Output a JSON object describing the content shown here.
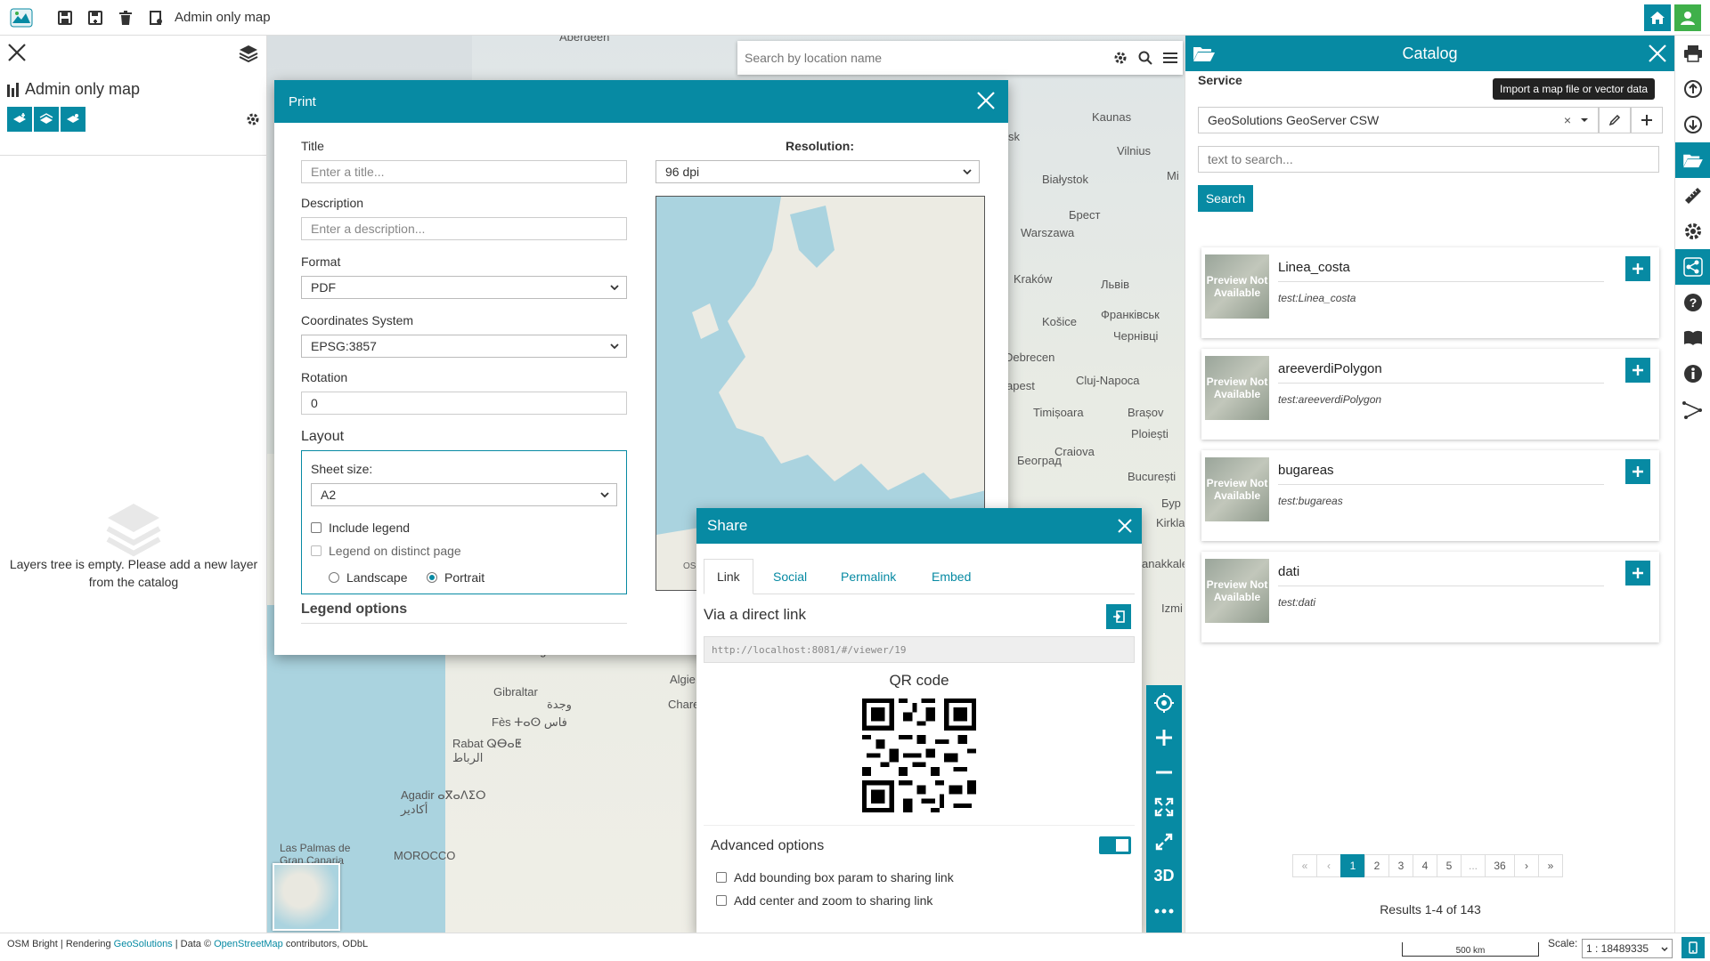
{
  "topbar": {
    "title": "Admin only map"
  },
  "left_panel": {
    "title": "Admin only map",
    "empty_message": "Layers tree is empty. Please add a new layer from the catalog"
  },
  "search": {
    "placeholder": "Search by location name"
  },
  "map_labels": [
    "Aberdeen",
    "Kaunas",
    "Vilnius",
    "Białystok",
    "Брест",
    "Warszawa",
    "Kraków",
    "Львів",
    "Košice",
    "Франківськ",
    "Чернівці",
    "Debrecen",
    "Cluj-Napoca",
    "apest",
    "Timișoara",
    "Brașov",
    "Ploiești",
    "Craiova",
    "Београд",
    "București",
    "Бур",
    "Kirkla",
    "anakkale",
    "Izmi",
    "Gibraltar",
    "Algie",
    "Chare",
    "Fès ⵜⴰⵙ فاس",
    "Rabat ⵕⴱⴰⵟ الرباط",
    "Agadir ⴰⴳⴰⴷⵉⵔ أكادير",
    "MOROCCO",
    "Las Palmas de Gran Canaria",
    "Málaga",
    "وجدة",
    "Mi",
    "sk"
  ],
  "print": {
    "title": "Print",
    "title_label": "Title",
    "title_placeholder": "Enter a title...",
    "description_label": "Description",
    "description_placeholder": "Enter a description...",
    "format_label": "Format",
    "format_value": "PDF",
    "crs_label": "Coordinates System",
    "crs_value": "EPSG:3857",
    "rotation_label": "Rotation",
    "rotation_value": "0",
    "layout_label": "Layout",
    "sheet_label": "Sheet size:",
    "sheet_value": "A2",
    "include_legend": "Include legend",
    "legend_distinct": "Legend on distinct page",
    "landscape": "Landscape",
    "portrait": "Portrait",
    "legend_options": "Legend options",
    "resolution_label": "Resolution:",
    "resolution_value": "96 dpi",
    "preview_attribution": "OS"
  },
  "share": {
    "title": "Share",
    "tabs": [
      "Link",
      "Social",
      "Permalink",
      "Embed"
    ],
    "direct_link_label": "Via a direct link",
    "link_value": "http://localhost:8081/#/viewer/19",
    "qr_label": "QR code",
    "advanced": "Advanced options",
    "bbox_option": "Add bounding box param to sharing link",
    "center_option": "Add center and zoom to sharing link"
  },
  "catalog": {
    "title": "Catalog",
    "service_label": "Service",
    "service_value": "GeoSolutions GeoServer CSW",
    "search_placeholder": "text to search...",
    "search_button": "Search",
    "preview_text": "Preview Not Available",
    "records": [
      {
        "title": "Linea_costa",
        "subtitle": "test:Linea_costa"
      },
      {
        "title": "areeverdiPolygon",
        "subtitle": "test:areeverdiPolygon"
      },
      {
        "title": "bugareas",
        "subtitle": "test:bugareas"
      },
      {
        "title": "dati",
        "subtitle": "test:dati"
      }
    ],
    "pagination": [
      "«",
      "‹",
      "1",
      "2",
      "3",
      "4",
      "5",
      "...",
      "36",
      "›",
      "»"
    ],
    "results": "Results 1-4 of 143"
  },
  "tooltip": "Import a map file or vector data",
  "map_controls": {
    "three_d": "3D"
  },
  "bottom": {
    "attribution_prefix": "OSM Bright | Rendering ",
    "attribution_geo": "GeoSolutions",
    "attribution_mid": " | Data © ",
    "attribution_osm": "OpenStreetMap",
    "attribution_suffix": " contributors, ODbL",
    "scale_bar": "500 km",
    "scale_label": "Scale:",
    "scale_value": "1 : 18489335"
  },
  "colors": {
    "primary": "#078aa3",
    "home_button": "#078aa3",
    "user_button": "#3fb04a"
  }
}
